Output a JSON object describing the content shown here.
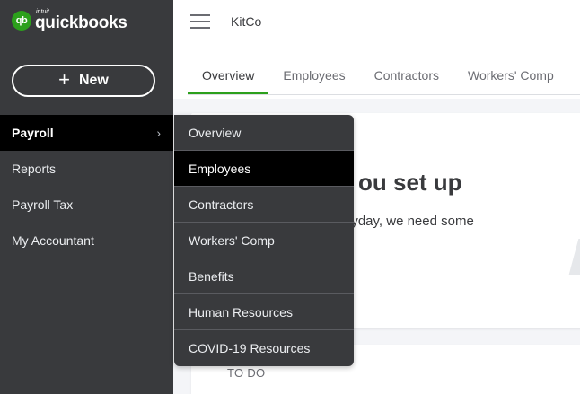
{
  "logo": {
    "mark": "qb",
    "intuit": "intuit",
    "name": "quickbooks"
  },
  "sidebar": {
    "new_button": {
      "plus": "+",
      "label": "New"
    },
    "items": [
      {
        "label": "Payroll",
        "chevron": "›"
      },
      {
        "label": "Reports"
      },
      {
        "label": "Payroll Tax"
      },
      {
        "label": "My Accountant"
      }
    ]
  },
  "header": {
    "company": "KitCo",
    "tabs": [
      {
        "label": "Overview"
      },
      {
        "label": "Employees"
      },
      {
        "label": "Contractors"
      },
      {
        "label": "Workers' Comp"
      }
    ]
  },
  "main": {
    "card_title": "ou set up",
    "card_body": "eyday, we need some",
    "todo_label": "TO DO"
  },
  "flyout": {
    "items": [
      {
        "label": "Overview"
      },
      {
        "label": "Employees"
      },
      {
        "label": "Contractors"
      },
      {
        "label": "Workers' Comp"
      },
      {
        "label": "Benefits"
      },
      {
        "label": "Human Resources"
      },
      {
        "label": "COVID-19 Resources"
      }
    ]
  },
  "colors": {
    "brand_green": "#2ca01c",
    "sidebar_bg": "#393a3d",
    "active_bg": "#000000"
  }
}
